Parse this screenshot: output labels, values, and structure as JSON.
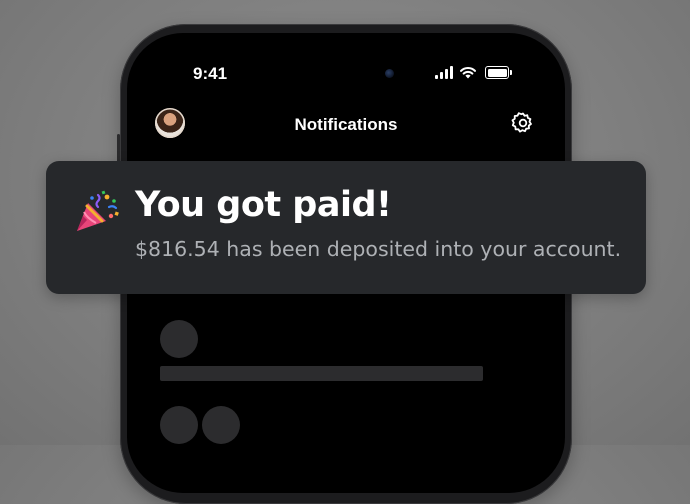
{
  "status_bar": {
    "time": "9:41",
    "icons": [
      "signal-icon",
      "wifi-icon",
      "battery-icon"
    ]
  },
  "header": {
    "title": "Notifications",
    "left_icon": "avatar",
    "right_icon": "gear-icon"
  },
  "toast": {
    "icon": "party-popper-icon",
    "title": "You got paid!",
    "message": "$816.54 has been deposited into your account."
  },
  "colors": {
    "background": "#808080",
    "phone_screen": "#000000",
    "toast_background": "#26282b",
    "toast_title": "#ffffff",
    "toast_message": "#aeb1b5",
    "placeholder": "#2c2c2e"
  }
}
